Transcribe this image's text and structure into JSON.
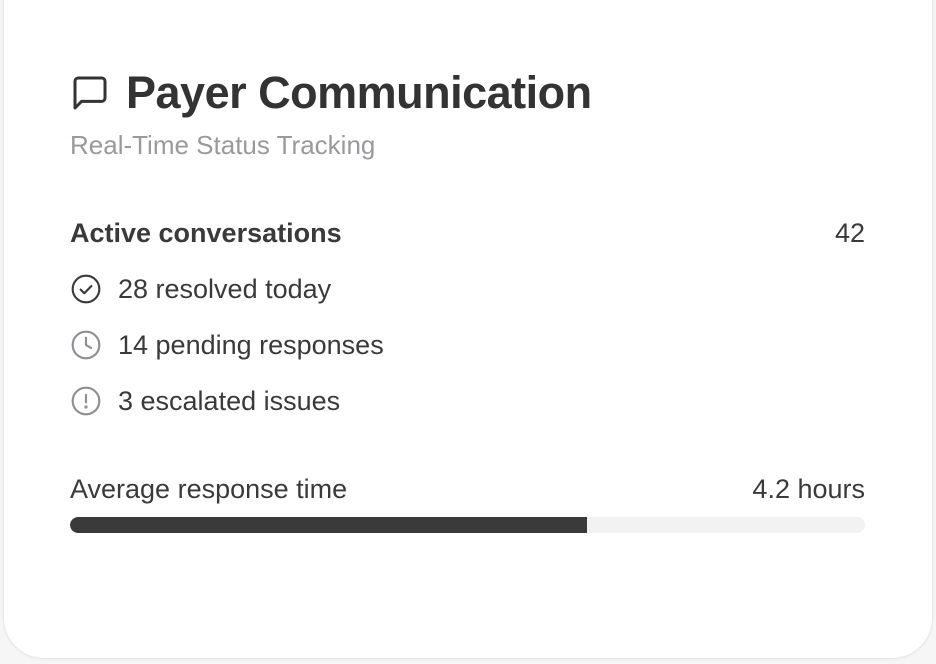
{
  "card": {
    "title": "Payer Communication",
    "title_icon": "message-square-icon",
    "subtitle": "Real-Time Status Tracking"
  },
  "active": {
    "label": "Active conversations",
    "value": "42"
  },
  "stats": [
    {
      "icon": "check-circle-icon",
      "text": "28 resolved today"
    },
    {
      "icon": "clock-icon",
      "text": "14 pending responses"
    },
    {
      "icon": "alert-circle-icon",
      "text": "3 escalated issues"
    }
  ],
  "response": {
    "label": "Average response time",
    "value": "4.2 hours",
    "progress_fraction": 0.65
  },
  "colors": {
    "text": "#3a3a3a",
    "muted": "#9a9a9e",
    "track": "#f2f2f2",
    "fill": "#3a3a3a"
  }
}
